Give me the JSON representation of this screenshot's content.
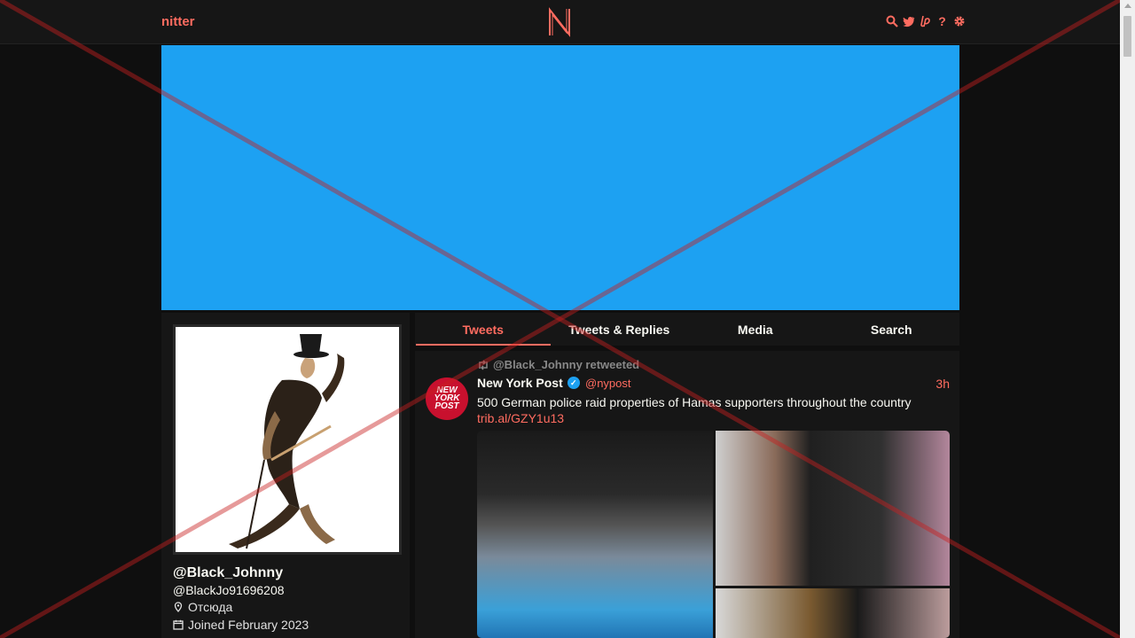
{
  "nav": {
    "brand": "nitter",
    "logo_letter": "N",
    "icons": [
      "search-icon",
      "twitter-icon",
      "liberapay-icon",
      "help-icon",
      "gear-icon"
    ],
    "help_glyph": "?"
  },
  "colors": {
    "accent": "#ff6c60",
    "banner": "#1da1f2",
    "background": "#0f0f0f",
    "panel": "#161616"
  },
  "profile": {
    "name": "@Black_Johnny",
    "handle": "@BlackJo91696208",
    "location": "Отсюда",
    "joined": "Joined February 2023"
  },
  "tabs": [
    {
      "label": "Tweets",
      "active": true
    },
    {
      "label": "Tweets & Replies",
      "active": false
    },
    {
      "label": "Media",
      "active": false
    },
    {
      "label": "Search",
      "active": false
    }
  ],
  "tweet": {
    "retweet_header": "@Black_Johnny retweeted",
    "author_name": "New York Post",
    "author_handle": "@nypost",
    "date": "3h",
    "text": "500 German police raid properties of Hamas supporters throughout the country",
    "link": "trib.al/GZY1u13",
    "avatar_text": "NEW YORK POST"
  }
}
